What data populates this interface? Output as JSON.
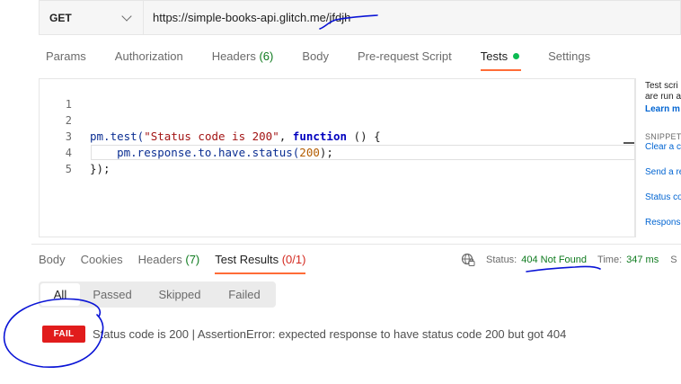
{
  "request": {
    "method": "GET",
    "url": "https://simple-books-api.glitch.me/jfdjh"
  },
  "request_tabs": [
    {
      "label": "Params",
      "count": ""
    },
    {
      "label": "Authorization",
      "count": ""
    },
    {
      "label": "Headers",
      "count": "(6)"
    },
    {
      "label": "Body",
      "count": ""
    },
    {
      "label": "Pre-request Script",
      "count": ""
    },
    {
      "label": "Tests",
      "count": ""
    },
    {
      "label": "Settings",
      "count": ""
    }
  ],
  "editor": {
    "line_numbers": [
      "1",
      "2",
      "3",
      "4",
      "5"
    ],
    "line2": {
      "a": "pm.test(",
      "b": "\"Status code is 200\"",
      "c": ", ",
      "d": "function",
      "e": " () {"
    },
    "line3": {
      "a": "    pm.response.to.have.status(",
      "b": "200",
      "c": ");"
    },
    "line4": {
      "a": "});"
    }
  },
  "side_panel": {
    "text1": "Test scri",
    "text2": "are run a",
    "learn": "Learn m",
    "snippets": "SNIPPET",
    "clear": "Clear a c",
    "s1": "Send a re",
    "s2": "Status co",
    "s3": "Respons"
  },
  "response_tabs": [
    {
      "label": "Body",
      "count": ""
    },
    {
      "label": "Cookies",
      "count": ""
    },
    {
      "label": "Headers",
      "count": "(7)"
    },
    {
      "label": "Test Results",
      "count": "(0/1)"
    }
  ],
  "status": {
    "status_label": "Status:",
    "status_value": "404 Not Found",
    "time_label": "Time:",
    "time_value": "347 ms",
    "more": "S"
  },
  "filters": [
    "All",
    "Passed",
    "Skipped",
    "Failed"
  ],
  "result": {
    "badge": "FAIL",
    "text": "Status code is 200 | AssertionError: expected response to have status code 200 but got 404"
  },
  "colors": {
    "accent": "#ff6c37",
    "fail": "#e11c1c",
    "success_dot": "#0cbb52",
    "annotation": "#0a14d6"
  }
}
